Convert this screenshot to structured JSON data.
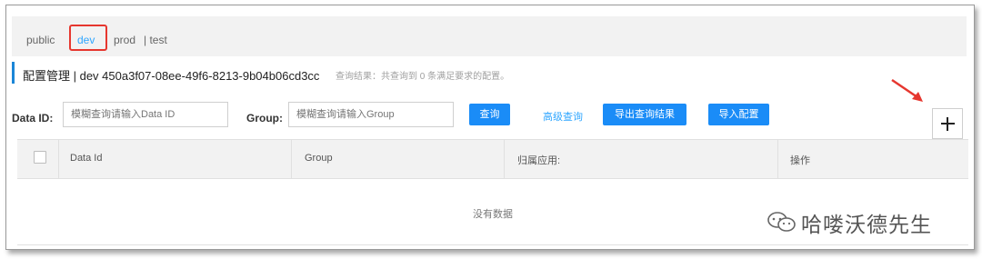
{
  "namespaces": {
    "items": [
      {
        "label": "public",
        "active": false
      },
      {
        "label": "dev",
        "active": true
      },
      {
        "label": "prod",
        "active": false
      },
      {
        "label": "| test",
        "active": false
      }
    ]
  },
  "header": {
    "title": "配置管理  |  dev  450a3f07-08ee-49f6-8213-9b04b06cd3cc",
    "hint": "查询结果：共查询到 0 条满足要求的配置。"
  },
  "filters": {
    "data_id_label": "Data ID:",
    "data_id_placeholder": "模糊查询请输入Data ID",
    "group_label": "Group:",
    "group_placeholder": "模糊查询请输入Group",
    "search_button": "查询",
    "advanced_search": "高级查询",
    "export_button": "导出查询结果",
    "import_button": "导入配置"
  },
  "table": {
    "columns": [
      "Data Id",
      "Group",
      "归属应用:",
      "操作"
    ],
    "empty_text": "没有数据"
  },
  "watermark": {
    "text": "哈喽沃德先生"
  },
  "colors": {
    "accent": "#1a8cf7",
    "highlight_box": "#e6372f",
    "arrow": "#e6372f"
  },
  "icons": {
    "add": "plus-icon",
    "annotation": "red-arrow-icon",
    "watermark": "wechat-icon"
  }
}
